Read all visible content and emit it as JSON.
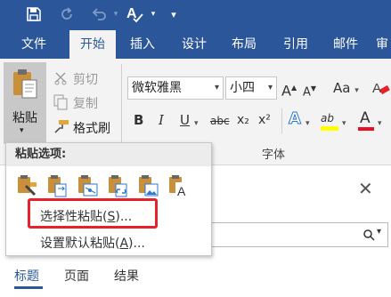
{
  "quick_access": {
    "save_icon": "save-icon",
    "undo_icon": "undo-icon",
    "redo_icon": "redo-icon",
    "spelling_icon": "spelling-icon",
    "customize_label": "▾"
  },
  "tabs": [
    {
      "label": "文件",
      "active": false
    },
    {
      "label": "开始",
      "active": true
    },
    {
      "label": "插入",
      "active": false
    },
    {
      "label": "设计",
      "active": false
    },
    {
      "label": "布局",
      "active": false
    },
    {
      "label": "引用",
      "active": false
    },
    {
      "label": "邮件",
      "active": false
    },
    {
      "label": "审",
      "active": false
    }
  ],
  "clipboard": {
    "paste_label": "粘贴",
    "cut_label": "剪切",
    "copy_label": "复制",
    "format_painter_label": "格式刷"
  },
  "font": {
    "font_name": "微软雅黑",
    "font_size": "小四",
    "group_label": "字体",
    "grow_label": "A",
    "shrink_label": "A",
    "case_label": "Aa",
    "bold": "B",
    "italic": "I",
    "underline": "U",
    "strike": "abc",
    "subscript": "x₂",
    "superscript": "x²",
    "text_effect": "A",
    "highlight": "ab",
    "font_color": "A"
  },
  "paste_menu": {
    "header": "粘贴选项:",
    "items": [
      {
        "text_before": "选择性粘贴(",
        "key": "S",
        "text_after": ")..."
      },
      {
        "text_before": "设置默认粘贴(",
        "key": "A",
        "text_after": ")..."
      }
    ]
  },
  "pane": {
    "close_label": "✕",
    "tabs": [
      {
        "label": "标题",
        "active": true
      },
      {
        "label": "页面",
        "active": false
      },
      {
        "label": "结果",
        "active": false
      }
    ]
  },
  "colors": {
    "accent": "#2b579a",
    "highlight_border": "#e8202a",
    "highlight_yellow": "#ffff00",
    "font_color_red": "#e81123"
  }
}
